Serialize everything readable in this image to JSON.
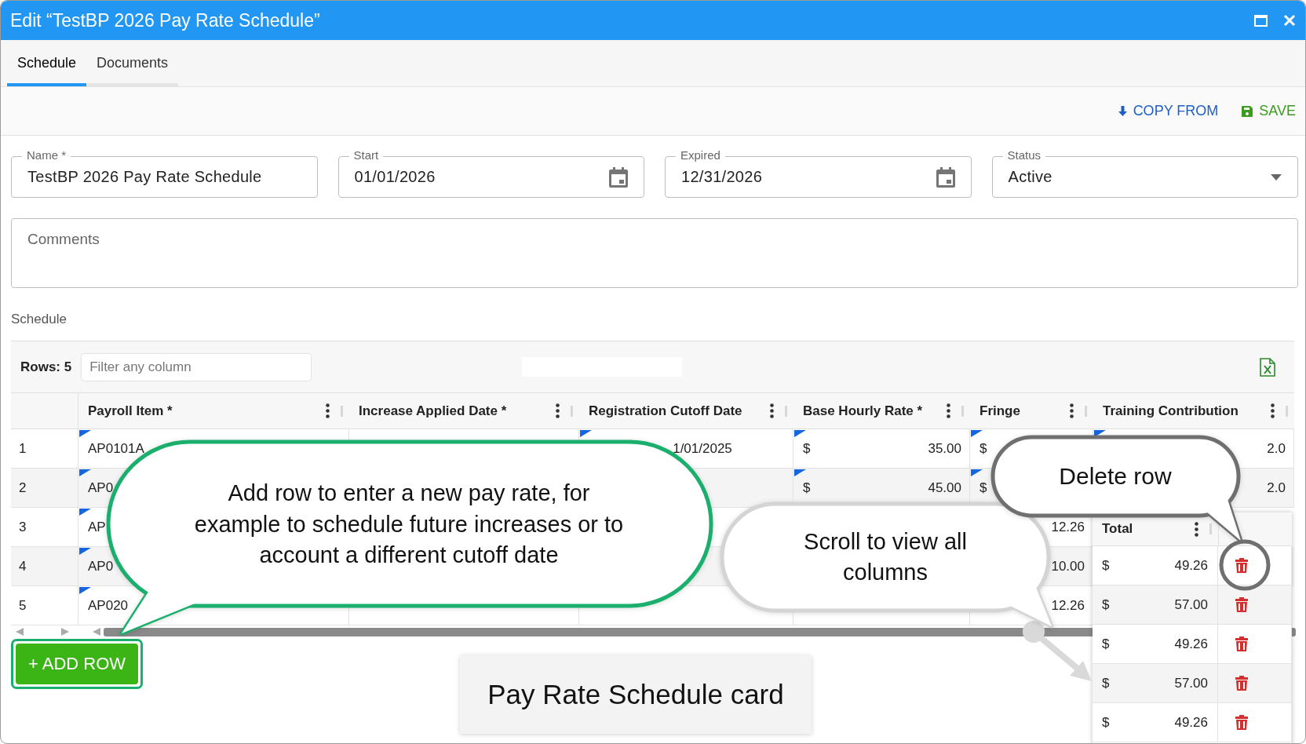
{
  "window": {
    "title": "Edit “TestBP 2026 Pay Rate Schedule”"
  },
  "tabs": [
    {
      "label": "Schedule",
      "selected": true
    },
    {
      "label": "Documents",
      "selected": false
    }
  ],
  "toolbar": {
    "actions": [
      {
        "kind": "copy",
        "label": "COPY FROM"
      },
      {
        "kind": "save",
        "label": "SAVE"
      }
    ]
  },
  "fields": [
    {
      "kind": "text",
      "label": "Name *",
      "value": "TestBP 2026 Pay Rate Schedule"
    },
    {
      "kind": "date",
      "label": "Start",
      "value": "01/01/2026"
    },
    {
      "kind": "date",
      "label": "Expired",
      "value": "12/31/2026"
    },
    {
      "kind": "select",
      "label": "Status",
      "value": "Active"
    }
  ],
  "comments": {
    "placeholder": "Comments"
  },
  "section_title": "Schedule",
  "grid": {
    "row_count": "Rows: 5",
    "filter": {
      "placeholder": "Filter any column"
    },
    "columns": [
      "Payroll Item *",
      "Increase Applied Date *",
      "Registration Cutoff Date",
      "Base Hourly Rate *",
      "Fringe",
      "Training Contribution"
    ],
    "rows": [
      {
        "number": "1",
        "payroll_item": "AP0101A",
        "registration_cutoff_date": "1/01/2025",
        "base_hourly_rate": {
          "currency": "$",
          "amount": "35.00"
        },
        "fringe": {
          "currency": "$"
        },
        "training_contribution": {
          "amount": "2.0"
        }
      },
      {
        "number": "2",
        "payroll_item": "AP0",
        "base_hourly_rate": {
          "currency": "$",
          "amount": "45.00"
        },
        "fringe": {
          "currency": "$"
        },
        "training_contribution": {
          "amount": "2.0"
        }
      },
      {
        "number": "3",
        "payroll_item": "AP",
        "fringe": {
          "amount": "12.26"
        }
      },
      {
        "number": "4",
        "payroll_item": "AP0",
        "fringe": {
          "amount": "10.00"
        }
      },
      {
        "number": "5",
        "payroll_item": "AP020",
        "fringe": {
          "amount": "12.26"
        }
      }
    ]
  },
  "add_row_button": "+ ADD ROW",
  "total_card": {
    "column": "Total",
    "rows": [
      {
        "currency": "$",
        "amount": "49.26"
      },
      {
        "currency": "$",
        "amount": "57.00"
      },
      {
        "currency": "$",
        "amount": "49.26"
      },
      {
        "currency": "$",
        "amount": "57.00"
      },
      {
        "currency": "$",
        "amount": "49.26"
      }
    ]
  },
  "callouts": [
    {
      "kind": "accent",
      "text": "Add row to enter a new pay rate, for example to schedule future increases or to account a different cutoff date"
    },
    {
      "kind": "soft",
      "text": "Scroll to view all columns"
    },
    {
      "kind": "dark",
      "text": "Delete row"
    }
  ],
  "caption": "Pay Rate Schedule card"
}
